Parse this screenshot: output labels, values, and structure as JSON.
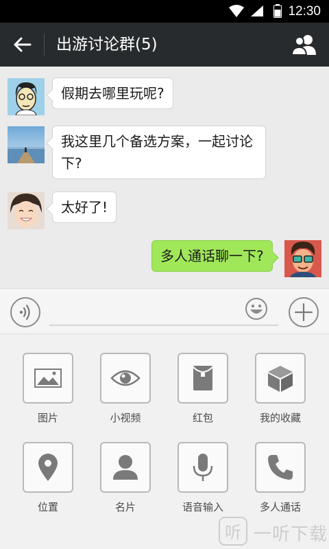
{
  "status_bar": {
    "time": "12:30"
  },
  "header": {
    "title": "出游讨论群(5)"
  },
  "messages": [
    {
      "text": "假期去哪里玩呢?",
      "side": "left",
      "avatar": "glasses-man-avatar"
    },
    {
      "text": "我这里几个备选方案，一起讨论下?",
      "side": "left",
      "avatar": "lake-scenery-avatar"
    },
    {
      "text": "太好了!",
      "side": "left",
      "avatar": "smiling-girl-avatar"
    },
    {
      "text": "多人通话聊一下?",
      "side": "right",
      "avatar": "cartoon-man-avatar"
    }
  ],
  "input": {
    "value": "",
    "placeholder": ""
  },
  "panel": {
    "items": [
      {
        "label": "图片",
        "icon": "image-icon"
      },
      {
        "label": "小视频",
        "icon": "eye-icon"
      },
      {
        "label": "红包",
        "icon": "red-packet-icon"
      },
      {
        "label": "我的收藏",
        "icon": "cube-icon"
      },
      {
        "label": "位置",
        "icon": "location-pin-icon"
      },
      {
        "label": "名片",
        "icon": "person-icon"
      },
      {
        "label": "语音输入",
        "icon": "microphone-icon"
      },
      {
        "label": "多人通话",
        "icon": "phone-icon"
      }
    ]
  },
  "watermark": {
    "text": "一听下载",
    "glyph": "听"
  },
  "colors": {
    "header_bg": "#272b2d",
    "my_bubble": "#a0e75a",
    "chat_bg": "#ebebeb"
  }
}
